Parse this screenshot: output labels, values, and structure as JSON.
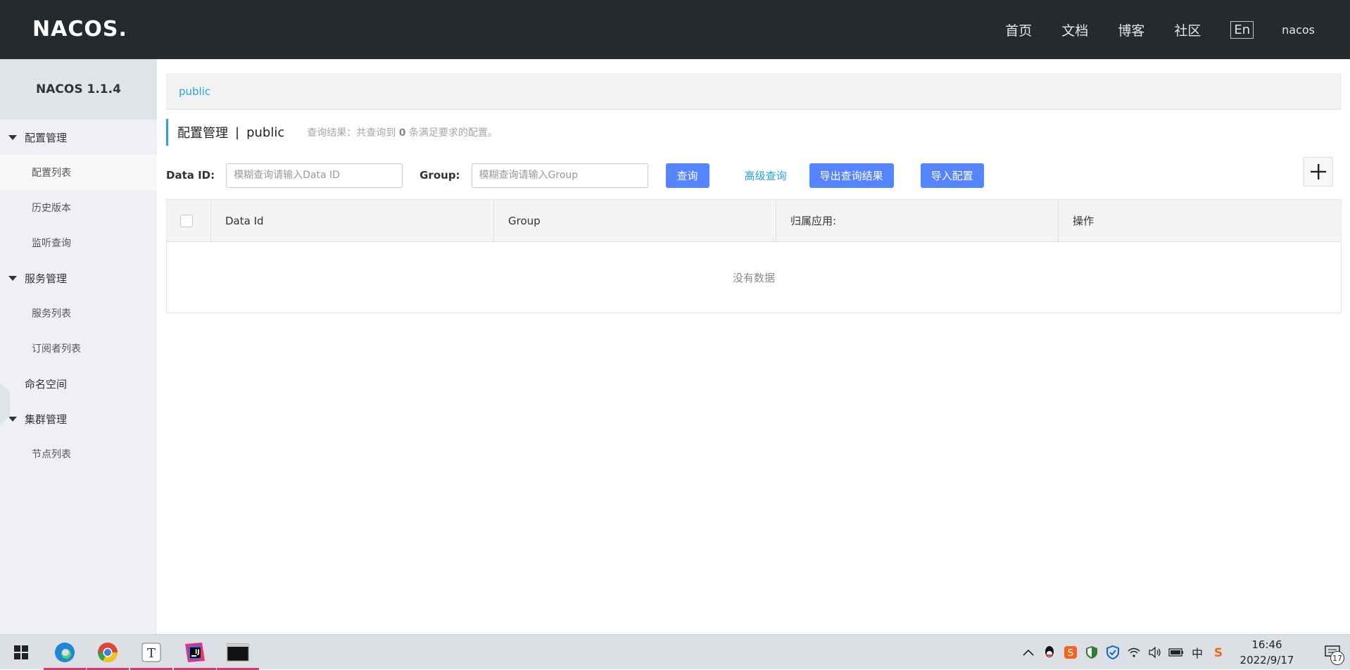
{
  "header": {
    "logo": "NACOS.",
    "nav": [
      "首页",
      "文档",
      "博客",
      "社区"
    ],
    "lang": "En",
    "user": "nacos"
  },
  "sidebar": {
    "title": "NACOS 1.1.4",
    "groups": [
      {
        "label": "配置管理",
        "items": [
          "配置列表",
          "历史版本",
          "监听查询"
        ]
      },
      {
        "label": "服务管理",
        "items": [
          "服务列表",
          "订阅者列表"
        ]
      },
      {
        "label": "命名空间",
        "items": []
      },
      {
        "label": "集群管理",
        "items": [
          "节点列表"
        ]
      }
    ]
  },
  "main": {
    "namespace_tab": "public",
    "title": "配置管理",
    "title_sep": "|",
    "title_ns": "public",
    "query_info_prefix": "查询结果：共查询到",
    "query_count": "0",
    "query_info_suffix": "条满足要求的配置。",
    "filters": {
      "data_id_label": "Data ID:",
      "data_id_placeholder": "模糊查询请输入Data ID",
      "data_id_value": "",
      "group_label": "Group:",
      "group_placeholder": "模糊查询请输入Group",
      "group_value": ""
    },
    "buttons": {
      "query": "查询",
      "advanced": "高级查询",
      "export": "导出查询结果",
      "import": "导入配置"
    },
    "table": {
      "columns": [
        "Data Id",
        "Group",
        "归属应用:",
        "操作"
      ],
      "empty": "没有数据"
    }
  },
  "taskbar": {
    "apps": [
      "start-icon",
      "edge-icon",
      "chrome-icon",
      "typora-icon",
      "intellij-icon",
      "terminal-icon"
    ],
    "time": "16:46",
    "date": "2022/9/17",
    "ime": "中",
    "notification_count": "17"
  }
}
